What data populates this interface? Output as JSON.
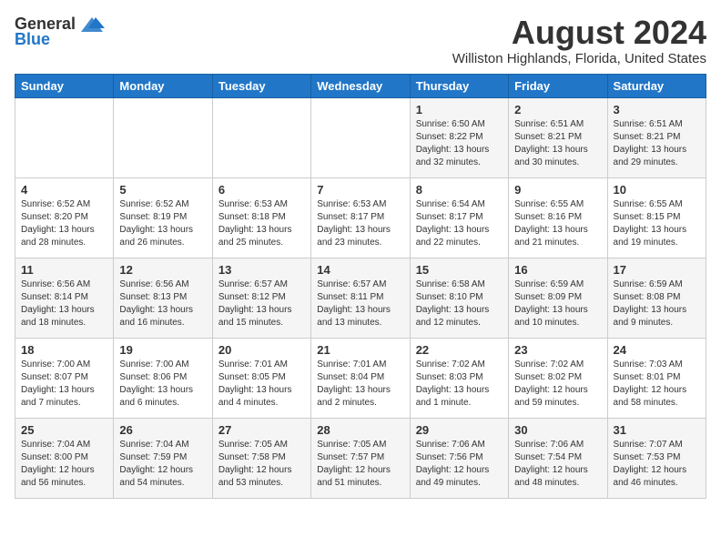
{
  "logo": {
    "general": "General",
    "blue": "Blue"
  },
  "title": {
    "month_year": "August 2024",
    "location": "Williston Highlands, Florida, United States"
  },
  "days_of_week": [
    "Sunday",
    "Monday",
    "Tuesday",
    "Wednesday",
    "Thursday",
    "Friday",
    "Saturday"
  ],
  "weeks": [
    [
      {
        "day": "",
        "info": ""
      },
      {
        "day": "",
        "info": ""
      },
      {
        "day": "",
        "info": ""
      },
      {
        "day": "",
        "info": ""
      },
      {
        "day": "1",
        "info": "Sunrise: 6:50 AM\nSunset: 8:22 PM\nDaylight: 13 hours\nand 32 minutes."
      },
      {
        "day": "2",
        "info": "Sunrise: 6:51 AM\nSunset: 8:21 PM\nDaylight: 13 hours\nand 30 minutes."
      },
      {
        "day": "3",
        "info": "Sunrise: 6:51 AM\nSunset: 8:21 PM\nDaylight: 13 hours\nand 29 minutes."
      }
    ],
    [
      {
        "day": "4",
        "info": "Sunrise: 6:52 AM\nSunset: 8:20 PM\nDaylight: 13 hours\nand 28 minutes."
      },
      {
        "day": "5",
        "info": "Sunrise: 6:52 AM\nSunset: 8:19 PM\nDaylight: 13 hours\nand 26 minutes."
      },
      {
        "day": "6",
        "info": "Sunrise: 6:53 AM\nSunset: 8:18 PM\nDaylight: 13 hours\nand 25 minutes."
      },
      {
        "day": "7",
        "info": "Sunrise: 6:53 AM\nSunset: 8:17 PM\nDaylight: 13 hours\nand 23 minutes."
      },
      {
        "day": "8",
        "info": "Sunrise: 6:54 AM\nSunset: 8:17 PM\nDaylight: 13 hours\nand 22 minutes."
      },
      {
        "day": "9",
        "info": "Sunrise: 6:55 AM\nSunset: 8:16 PM\nDaylight: 13 hours\nand 21 minutes."
      },
      {
        "day": "10",
        "info": "Sunrise: 6:55 AM\nSunset: 8:15 PM\nDaylight: 13 hours\nand 19 minutes."
      }
    ],
    [
      {
        "day": "11",
        "info": "Sunrise: 6:56 AM\nSunset: 8:14 PM\nDaylight: 13 hours\nand 18 minutes."
      },
      {
        "day": "12",
        "info": "Sunrise: 6:56 AM\nSunset: 8:13 PM\nDaylight: 13 hours\nand 16 minutes."
      },
      {
        "day": "13",
        "info": "Sunrise: 6:57 AM\nSunset: 8:12 PM\nDaylight: 13 hours\nand 15 minutes."
      },
      {
        "day": "14",
        "info": "Sunrise: 6:57 AM\nSunset: 8:11 PM\nDaylight: 13 hours\nand 13 minutes."
      },
      {
        "day": "15",
        "info": "Sunrise: 6:58 AM\nSunset: 8:10 PM\nDaylight: 13 hours\nand 12 minutes."
      },
      {
        "day": "16",
        "info": "Sunrise: 6:59 AM\nSunset: 8:09 PM\nDaylight: 13 hours\nand 10 minutes."
      },
      {
        "day": "17",
        "info": "Sunrise: 6:59 AM\nSunset: 8:08 PM\nDaylight: 13 hours\nand 9 minutes."
      }
    ],
    [
      {
        "day": "18",
        "info": "Sunrise: 7:00 AM\nSunset: 8:07 PM\nDaylight: 13 hours\nand 7 minutes."
      },
      {
        "day": "19",
        "info": "Sunrise: 7:00 AM\nSunset: 8:06 PM\nDaylight: 13 hours\nand 6 minutes."
      },
      {
        "day": "20",
        "info": "Sunrise: 7:01 AM\nSunset: 8:05 PM\nDaylight: 13 hours\nand 4 minutes."
      },
      {
        "day": "21",
        "info": "Sunrise: 7:01 AM\nSunset: 8:04 PM\nDaylight: 13 hours\nand 2 minutes."
      },
      {
        "day": "22",
        "info": "Sunrise: 7:02 AM\nSunset: 8:03 PM\nDaylight: 13 hours\nand 1 minute."
      },
      {
        "day": "23",
        "info": "Sunrise: 7:02 AM\nSunset: 8:02 PM\nDaylight: 12 hours\nand 59 minutes."
      },
      {
        "day": "24",
        "info": "Sunrise: 7:03 AM\nSunset: 8:01 PM\nDaylight: 12 hours\nand 58 minutes."
      }
    ],
    [
      {
        "day": "25",
        "info": "Sunrise: 7:04 AM\nSunset: 8:00 PM\nDaylight: 12 hours\nand 56 minutes."
      },
      {
        "day": "26",
        "info": "Sunrise: 7:04 AM\nSunset: 7:59 PM\nDaylight: 12 hours\nand 54 minutes."
      },
      {
        "day": "27",
        "info": "Sunrise: 7:05 AM\nSunset: 7:58 PM\nDaylight: 12 hours\nand 53 minutes."
      },
      {
        "day": "28",
        "info": "Sunrise: 7:05 AM\nSunset: 7:57 PM\nDaylight: 12 hours\nand 51 minutes."
      },
      {
        "day": "29",
        "info": "Sunrise: 7:06 AM\nSunset: 7:56 PM\nDaylight: 12 hours\nand 49 minutes."
      },
      {
        "day": "30",
        "info": "Sunrise: 7:06 AM\nSunset: 7:54 PM\nDaylight: 12 hours\nand 48 minutes."
      },
      {
        "day": "31",
        "info": "Sunrise: 7:07 AM\nSunset: 7:53 PM\nDaylight: 12 hours\nand 46 minutes."
      }
    ]
  ]
}
